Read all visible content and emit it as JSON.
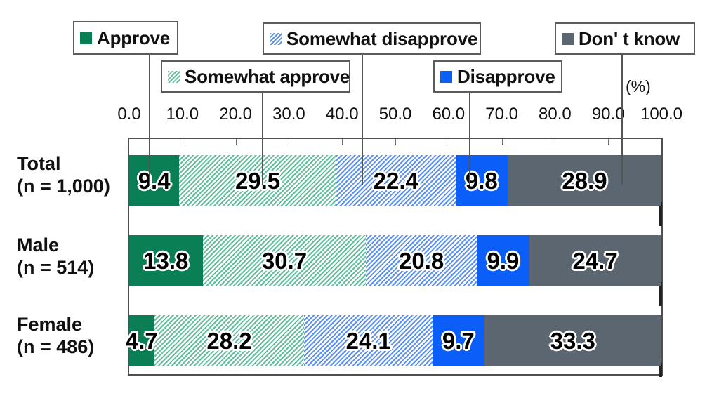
{
  "chart_data": {
    "type": "bar",
    "orientation": "horizontal",
    "stacked": true,
    "stacked_100": true,
    "title": "",
    "subtitle": "",
    "xlabel": "",
    "ylabel": "",
    "unit_label": "(%)",
    "xlim": [
      0,
      100
    ],
    "grid": false,
    "legend_position": "top",
    "categories": [
      "Total\n(n = 1,000)",
      "Male\n(n = 514)",
      "Female\n(n = 486)"
    ],
    "tick_labels": [
      "0.0",
      "10.0",
      "20.0",
      "30.0",
      "40.0",
      "50.0",
      "60.0",
      "70.0",
      "80.0",
      "90.0",
      "100.0"
    ],
    "tick_values": [
      0,
      10,
      20,
      30,
      40,
      50,
      60,
      70,
      80,
      90,
      100
    ],
    "series": [
      {
        "name": "Approve",
        "color": "#0a7f56",
        "pattern": "solid",
        "values": [
          9.4,
          13.8,
          4.7
        ]
      },
      {
        "name": "Somewhat approve",
        "color": "#62bd9b",
        "pattern": "hatched",
        "values": [
          29.5,
          30.7,
          28.2
        ]
      },
      {
        "name": "Somewhat disapprove",
        "color": "#5c90f0",
        "pattern": "hatched",
        "values": [
          22.4,
          20.8,
          24.1
        ]
      },
      {
        "name": "Disapprove",
        "color": "#0b5ef7",
        "pattern": "solid",
        "values": [
          9.8,
          9.9,
          9.7
        ]
      },
      {
        "name": "Don' t know",
        "color": "#5c6670",
        "pattern": "solid",
        "values": [
          28.9,
          24.7,
          33.3
        ]
      }
    ]
  },
  "legend": {
    "items": [
      {
        "label": "Approve",
        "swatch": "approve-swatch-icon"
      },
      {
        "label": "Somewhat approve",
        "swatch": "somewhat-approve-swatch-icon"
      },
      {
        "label": "Somewhat disapprove",
        "swatch": "somewhat-disapprove-swatch-icon"
      },
      {
        "label": "Disapprove",
        "swatch": "disapprove-swatch-icon"
      },
      {
        "label": "Don' t know",
        "swatch": "dont-know-swatch-icon"
      }
    ]
  },
  "axis": {
    "unit": "(%)",
    "ticks": [
      "0.0",
      "10.0",
      "20.0",
      "30.0",
      "40.0",
      "50.0",
      "60.0",
      "70.0",
      "80.0",
      "90.0",
      "100.0"
    ]
  },
  "rows": [
    {
      "name_line1": "Total",
      "name_line2": "(n = 1,000)",
      "values": [
        "9.4",
        "29.5",
        "22.4",
        "9.8",
        "28.9"
      ]
    },
    {
      "name_line1": "Male",
      "name_line2": "(n = 514)",
      "values": [
        "13.8",
        "30.7",
        "20.8",
        "9.9",
        "24.7"
      ]
    },
    {
      "name_line1": "Female",
      "name_line2": "(n = 486)",
      "values": [
        "4.7",
        "28.2",
        "24.1",
        "9.7",
        "33.3"
      ]
    }
  ],
  "colors": {
    "approve": "#0a7f56",
    "somewhat_approve": "#62bd9b",
    "somewhat_disapprove": "#5c90f0",
    "disapprove": "#0b5ef7",
    "dont_know": "#5c6670",
    "frame": "#4f4f4f",
    "text": "#111111"
  }
}
